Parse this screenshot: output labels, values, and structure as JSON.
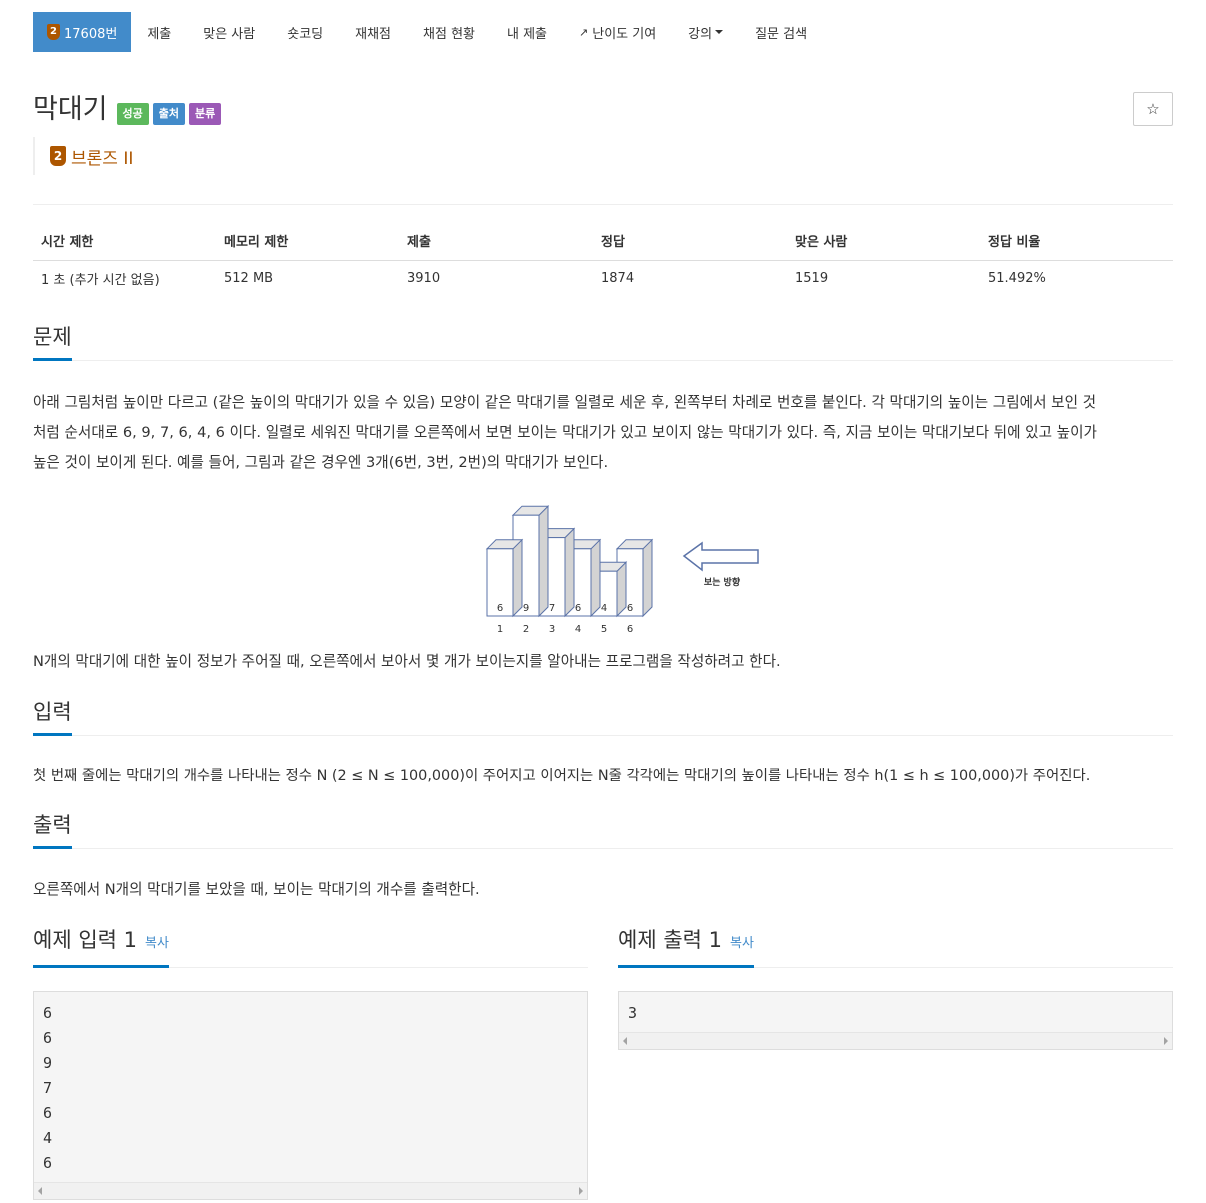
{
  "nav": {
    "problem_badge": "2",
    "problem_id": "17608번",
    "items": [
      "제출",
      "맞은 사람",
      "숏코딩",
      "재채점",
      "채점 현황",
      "내 제출",
      "난이도 기여",
      "강의",
      "질문 검색"
    ]
  },
  "problem": {
    "title": "막대기",
    "labels": [
      "성공",
      "출처",
      "분류"
    ],
    "star": "☆",
    "tier_badge": "2",
    "tier": "브론즈 II"
  },
  "info": {
    "headers": [
      "시간 제한",
      "메모리 제한",
      "제출",
      "정답",
      "맞은 사람",
      "정답 비율"
    ],
    "values": [
      "1 초 (추가 시간 없음)",
      "512 MB",
      "3910",
      "1874",
      "1519",
      "51.492%"
    ]
  },
  "sections": {
    "description_title": "문제",
    "description_lines": [
      "아래 그림처럼 높이만 다르고 (같은 높이의 막대기가 있을 수 있음) 모양이 같은 막대기를 일렬로 세운 후, 왼쪽부터 차례로 번호를 붙인다. 각 막대기의 높이는 그림에서 보인 것",
      "처럼 순서대로 6, 9, 7, 6, 4, 6 이다. 일렬로 세워진 막대기를 오른쪽에서 보면 보이는 막대기가 있고 보이지 않는 막대기가 있다. 즉, 지금 보이는 막대기보다 뒤에 있고 높이가",
      "높은 것이 보이게 된다. 예를 들어, 그림과 같은 경우엔 3개(6번, 3번, 2번)의 막대기가 보인다."
    ],
    "description_after": "N개의 막대기에 대한 높이 정보가 주어질 때, 오른쪽에서 보아서 몇 개가 보이는지를 알아내는 프로그램을 작성하려고 한다.",
    "input_title": "입력",
    "input_text": "첫 번째 줄에는 막대기의 개수를 나타내는 정수 N (2 ≤ N ≤ 100,000)이 주어지고 이어지는 N줄 각각에는 막대기의 높이를 나타내는 정수 h(1 ≤ h ≤ 100,000)가 주어진다.",
    "output_title": "출력",
    "output_text": "오른쪽에서 N개의 막대기를 보았을 때, 보이는 막대기의 개수를 출력한다."
  },
  "figure": {
    "heights": [
      6,
      9,
      7,
      6,
      4,
      6
    ],
    "indices": [
      "1",
      "2",
      "3",
      "4",
      "5",
      "6"
    ],
    "arrow_label": "보는 방향"
  },
  "samples": {
    "input_title": "예제 입력 1",
    "output_title": "예제 출력 1",
    "copy_label": "복사",
    "input_text": "6\n6\n9\n7\n6\n4\n6",
    "output_text": "3"
  },
  "colors": {
    "primary": "#428bca",
    "success": "#5cb85c",
    "purple": "#9b59b6",
    "bronze": "#ad5600",
    "section_underline": "#0076c0"
  }
}
